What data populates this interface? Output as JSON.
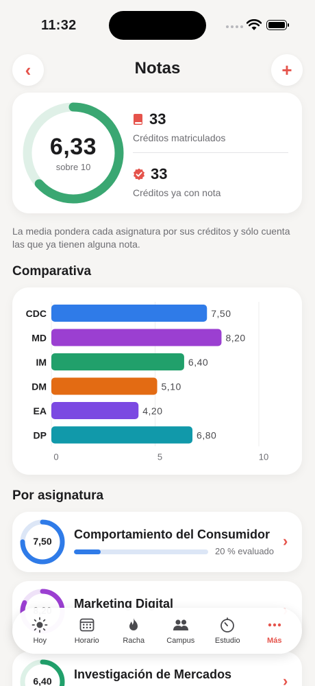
{
  "status_bar": {
    "time": "11:32"
  },
  "header": {
    "title": "Notas",
    "back_icon": "chevron-left-icon",
    "add_icon": "plus-icon",
    "back_glyph": "‹",
    "add_glyph": "+"
  },
  "summary": {
    "average": "6,33",
    "average_sub": "sobre 10",
    "ring_fraction": 0.633,
    "enrolled_credits": "33",
    "enrolled_label": "Créditos matriculados",
    "graded_credits": "33",
    "graded_label": "Créditos ya con nota"
  },
  "note": "La media pondera cada asignatura por sus créditos y sólo cuenta las que ya tienen alguna nota.",
  "comparison": {
    "title": "Comparativa"
  },
  "chart_data": {
    "type": "bar",
    "orientation": "horizontal",
    "categories": [
      "CDC",
      "MD",
      "IM",
      "DM",
      "EA",
      "DP"
    ],
    "values": [
      7.5,
      8.2,
      6.4,
      5.1,
      4.2,
      6.8
    ],
    "value_labels": [
      "7,50",
      "8,20",
      "6,40",
      "5,10",
      "4,20",
      "6,80"
    ],
    "colors": [
      "#2f7be8",
      "#9b3fd1",
      "#21a06b",
      "#e36b13",
      "#7b49e2",
      "#1199aa"
    ],
    "xlim": [
      0,
      10
    ],
    "xticks": [
      "0",
      "5",
      "10"
    ],
    "grid": true
  },
  "by_subject": {
    "title": "Por asignatura"
  },
  "subjects": [
    {
      "name": "Comportamiento del Consumidor",
      "grade": "7,50",
      "grade_value": 7.5,
      "evaluated": "20 % evaluado",
      "evaluated_fraction": 0.2,
      "color": "#2f7be8",
      "track": "#dce6f6"
    },
    {
      "name": "Marketing Digital",
      "grade": "8,20",
      "grade_value": 8.2,
      "color": "#9b3fd1",
      "track": "#efe2f8"
    },
    {
      "name": "Investigación de Mercados",
      "grade": "6,40",
      "grade_value": 6.4,
      "color": "#21a06b",
      "track": "#ddf1e7"
    }
  ],
  "tabbar": [
    {
      "label": "Hoy",
      "icon": "sun-icon",
      "active": false
    },
    {
      "label": "Horario",
      "icon": "calendar-icon",
      "active": false
    },
    {
      "label": "Racha",
      "icon": "flame-icon",
      "active": false
    },
    {
      "label": "Campus",
      "icon": "people-icon",
      "active": false
    },
    {
      "label": "Estudio",
      "icon": "timer-icon",
      "active": false
    },
    {
      "label": "Más",
      "icon": "more-icon",
      "active": true
    }
  ],
  "colors": {
    "accent": "#e5534b",
    "success": "#3aa772"
  }
}
